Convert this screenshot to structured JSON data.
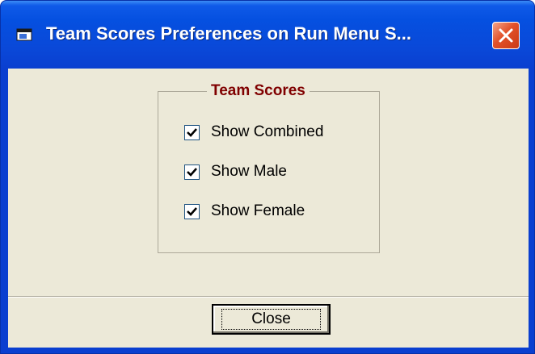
{
  "window": {
    "title": "Team Scores Preferences on Run Menu S..."
  },
  "group": {
    "legend": "Team Scores",
    "options": [
      {
        "label": "Show Combined",
        "checked": true
      },
      {
        "label": "Show Male",
        "checked": true
      },
      {
        "label": "Show Female",
        "checked": true
      }
    ]
  },
  "footer": {
    "close_label": "Close"
  },
  "colors": {
    "titlebar": "#0a3fd0",
    "client_background": "#ece9d8",
    "legend_text": "#800000",
    "close_x": "#e2512a"
  },
  "icons": {
    "window": "app-window-icon",
    "close": "close-icon",
    "check": "checkmark-icon"
  }
}
